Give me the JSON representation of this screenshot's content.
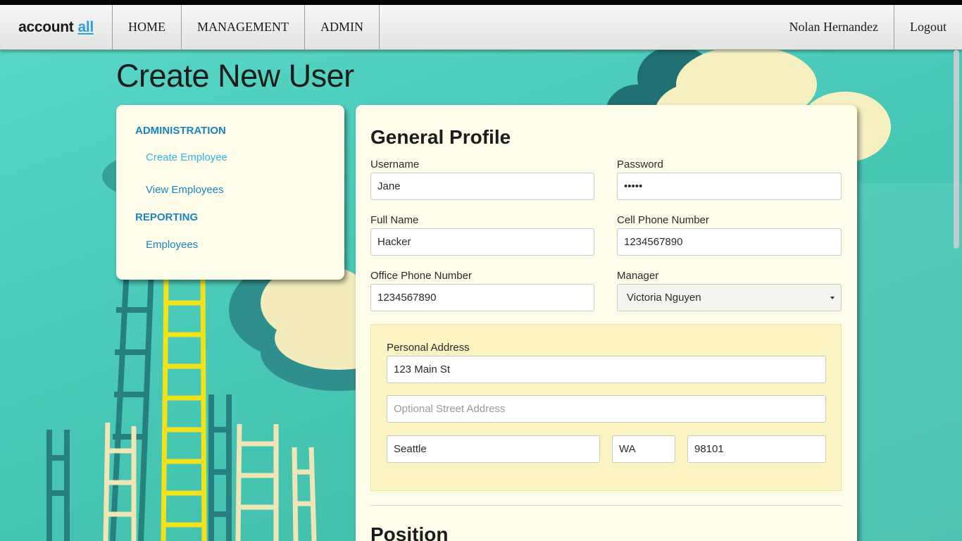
{
  "navbar": {
    "brand_main": "account",
    "brand_accent": "all",
    "links": [
      "HOME",
      "MANAGEMENT",
      "ADMIN"
    ],
    "user_name": "Nolan Hernandez",
    "logout_label": "Logout"
  },
  "page": {
    "title": "Create New User"
  },
  "sidebar": {
    "administration_heading": "ADMINISTRATION",
    "create_employee": "Create Employee",
    "view_employees": "View Employees",
    "reporting_heading": "REPORTING",
    "employees": "Employees"
  },
  "form": {
    "section_title": "General Profile",
    "username": {
      "label": "Username",
      "value": "Jane"
    },
    "password": {
      "label": "Password",
      "value": "•••••"
    },
    "full_name": {
      "label": "Full Name",
      "value": "Hacker"
    },
    "cell_phone": {
      "label": "Cell Phone Number",
      "value": "1234567890"
    },
    "office_phone": {
      "label": "Office Phone Number",
      "value": "1234567890"
    },
    "manager": {
      "label": "Manager",
      "value": "Victoria Nguyen"
    },
    "address": {
      "label": "Personal Address",
      "street": "123 Main St",
      "street2_placeholder": "Optional Street Address",
      "city": "Seattle",
      "state": "WA",
      "zip": "98101"
    },
    "next_section_title": "Position"
  },
  "colors": {
    "accent_link": "#1c83bf",
    "active_link": "#39b4e3",
    "card_bg": "#fdfde9",
    "address_bg": "#fbf3c2",
    "background_teal": "#4fcfbf"
  }
}
